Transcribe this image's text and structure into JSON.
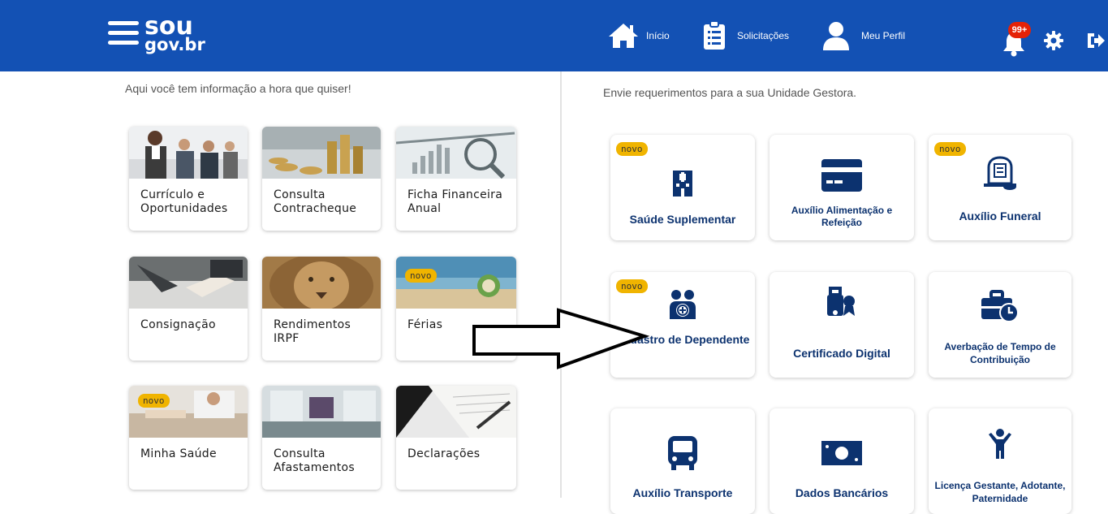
{
  "header": {
    "logo_line1": "sou",
    "logo_line2": "gov.br",
    "nav": {
      "inicio": "Início",
      "solicitacoes": "Solicitações",
      "meu_perfil": "Meu Perfil"
    },
    "notification_count": "99+",
    "colors": {
      "bar": "#1351b4",
      "badge": "#e52207"
    }
  },
  "left": {
    "intro": "Aqui você tem informação a hora que quiser!",
    "cards": [
      {
        "title": "Currículo e Oportunidades",
        "novo": false,
        "image": "business-people"
      },
      {
        "title": "Consulta Contracheque",
        "novo": false,
        "image": "coins-and-calculator"
      },
      {
        "title": "Ficha Financeira Anual",
        "novo": false,
        "image": "financial-chart"
      },
      {
        "title": "Consignação",
        "novo": false,
        "image": "handshake-desk"
      },
      {
        "title": "Rendimentos IRPF",
        "novo": false,
        "image": "lion"
      },
      {
        "title": "Férias",
        "novo": true,
        "image": "beach-coconut"
      },
      {
        "title": "Minha Saúde",
        "novo": true,
        "image": "doctor-consultation"
      },
      {
        "title": "Consulta Afastamentos",
        "novo": false,
        "image": "office-room"
      },
      {
        "title": "Declarações",
        "novo": false,
        "image": "signing-document"
      }
    ]
  },
  "right": {
    "intro": "Envie requerimentos para a sua Unidade Gestora.",
    "services": [
      {
        "title": "Saúde Suplementar",
        "novo": true,
        "icon": "hospital-icon"
      },
      {
        "title": "Auxílio Alimentação e Refeição",
        "novo": false,
        "icon": "credit-card-icon"
      },
      {
        "title": "Auxílio Funeral",
        "novo": true,
        "icon": "tombstone-icon"
      },
      {
        "title": "Cadastro de Dependente",
        "novo": true,
        "icon": "family-add-icon"
      },
      {
        "title": "Certificado Digital",
        "novo": false,
        "icon": "certificate-token-icon"
      },
      {
        "title": "Averbação de Tempo de Contribuição",
        "novo": false,
        "icon": "briefcase-clock-icon"
      },
      {
        "title": "Auxílio Transporte",
        "novo": false,
        "icon": "bus-icon"
      },
      {
        "title": "Dados Bancários",
        "novo": false,
        "icon": "money-bill-icon"
      },
      {
        "title": "Licença Gestante, Adotante, Paternidade",
        "novo": false,
        "icon": "child-icon"
      }
    ]
  },
  "novo_label": "novo",
  "accent_dark": "#0c326f",
  "novo_color": "#f0b400"
}
